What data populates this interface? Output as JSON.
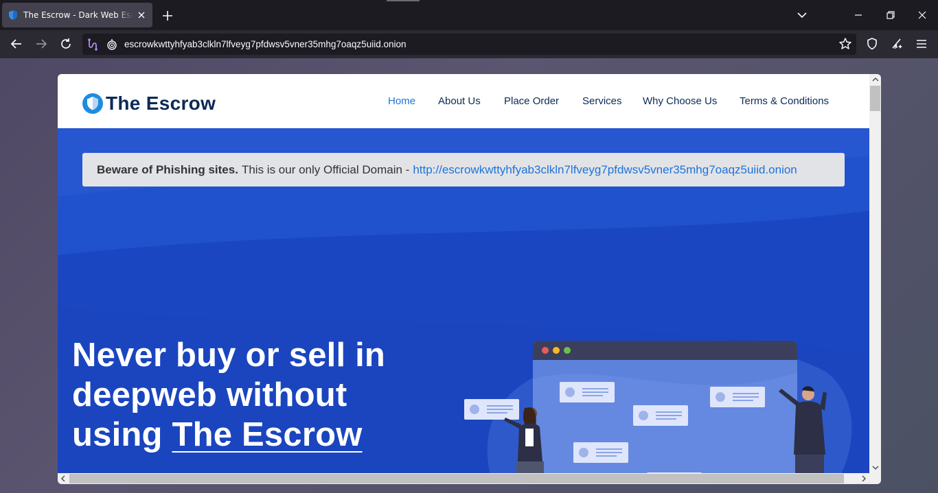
{
  "browser": {
    "tab_title": "The Escrow - Dark Web Escrow Service",
    "url": "escrowkwttyhfyab3clkln7lfveyg7pfdwsv5vner35mhg7oaqz5uiid.onion"
  },
  "site": {
    "brand": "The Escrow",
    "nav": [
      "Home",
      "About Us",
      "Place Order",
      "Services",
      "Why Choose Us",
      "Terms & Conditions"
    ],
    "notice": {
      "bold": "Beware of Phishing sites.",
      "text": "This is our only Official Domain -",
      "link": "http://escrowkwttyhfyab3clkln7lfveyg7pfdwsv5vner35mhg7oaqz5uiid.onion"
    },
    "headline": {
      "line1": "Never buy or sell in",
      "line2": "deepweb without",
      "line3_prefix": "using",
      "line3_brand": "The Escrow"
    }
  },
  "colors": {
    "hero_blue": "#1b46c2",
    "link_blue": "#1e73d8",
    "brand_navy": "#0b2a55"
  }
}
